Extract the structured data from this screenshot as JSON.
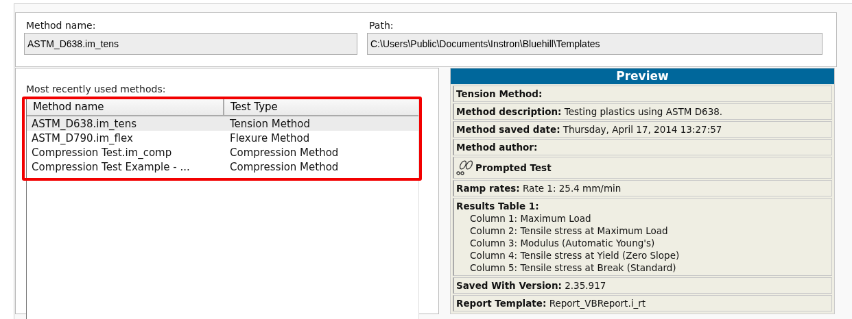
{
  "method_name": {
    "label": "Method name:",
    "value": "ASTM_D638.im_tens"
  },
  "path": {
    "label": "Path:",
    "value": "C:\\Users\\Public\\Documents\\Instron\\Bluehill\\Templates"
  },
  "recent": {
    "label": "Most recently used methods:",
    "highlighted": true,
    "columns": [
      "Method name",
      "Test Type"
    ],
    "rows": [
      {
        "name": "ASTM_D638.im_tens",
        "type": "Tension Method",
        "selected": true
      },
      {
        "name": "ASTM_D790.im_flex",
        "type": "Flexure Method",
        "selected": false
      },
      {
        "name": "Compression Test.im_comp",
        "type": "Compression Method",
        "selected": false
      },
      {
        "name": "Compression Test Example - ...",
        "type": "Compression Method",
        "selected": false
      }
    ]
  },
  "preview": {
    "title": "Preview",
    "rows": [
      {
        "kind": "field",
        "text": "**Tension Method:**"
      },
      {
        "kind": "field",
        "text": "**Method description:** Testing plastics using ASTM D638."
      },
      {
        "kind": "field",
        "text": "**Method saved date:** Thursday, April 17, 2014 13:27:57"
      },
      {
        "kind": "field",
        "text": "**Method author:**"
      },
      {
        "kind": "prompted",
        "text": "Prompted Test"
      },
      {
        "kind": "field",
        "text": "**Ramp rates:** Rate 1: 25.4 mm/min"
      },
      {
        "kind": "table",
        "text": "Results Table 1:",
        "lines": [
          "Column 1: Maximum Load",
          "Column 2: Tensile stress at Maximum Load",
          "Column 3: Modulus (Automatic Young's)",
          "Column 4: Tensile stress at Yield (Zero Slope)",
          "Column 5: Tensile stress at Break (Standard)"
        ]
      },
      {
        "kind": "field",
        "text": "**Saved With Version:** 2.35.917"
      },
      {
        "kind": "field",
        "text": "**Report Template:** Report_VBReport.i_rt"
      }
    ]
  }
}
